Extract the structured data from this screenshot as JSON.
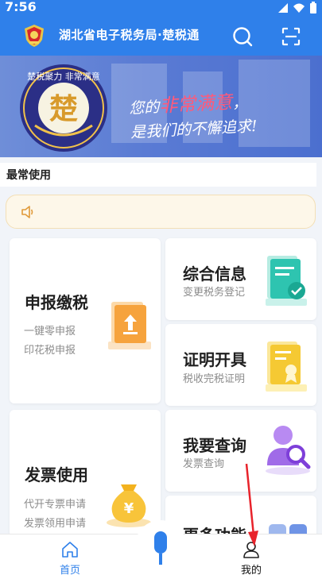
{
  "status_bar": {
    "time": "7:56"
  },
  "header": {
    "title": "湖北省电子税务局·楚税通",
    "search_icon": "search-icon",
    "scan_icon": "scan-icon"
  },
  "banner": {
    "badge_text": "楚税聚力 非常满意",
    "badge_glyph": "楚",
    "line1_prefix": "您的",
    "line1_highlight": "非常满意",
    "line1_suffix": "，",
    "line2": "是我们的不懈追求!"
  },
  "section": {
    "title": "最常使用"
  },
  "notice": {
    "icon": "speaker-icon",
    "text": ""
  },
  "cards": {
    "declare": {
      "title": "申报缴税",
      "sub1": "一键零申报",
      "sub2": "印花税申报",
      "icon": "upload-folder-icon"
    },
    "info": {
      "title": "综合信息",
      "sub1": "变更税务登记",
      "icon": "document-check-icon"
    },
    "certificate": {
      "title": "证明开具",
      "sub1": "税收完税证明",
      "icon": "certificate-icon"
    },
    "invoice": {
      "title": "发票使用",
      "sub1": "代开专票申请",
      "sub2": "发票领用申请",
      "icon": "money-bag-icon"
    },
    "query": {
      "title": "我要查询",
      "sub1": "发票查询",
      "icon": "user-search-icon"
    },
    "more": {
      "title": "更多功能",
      "icon": "grid-icon"
    }
  },
  "nav": {
    "home": "首页",
    "mine": "我的",
    "mic_icon": "microphone-icon"
  },
  "colors": {
    "primary": "#2f80ea",
    "annotation": "#e8232b",
    "highlight": "#ff5a7a"
  }
}
